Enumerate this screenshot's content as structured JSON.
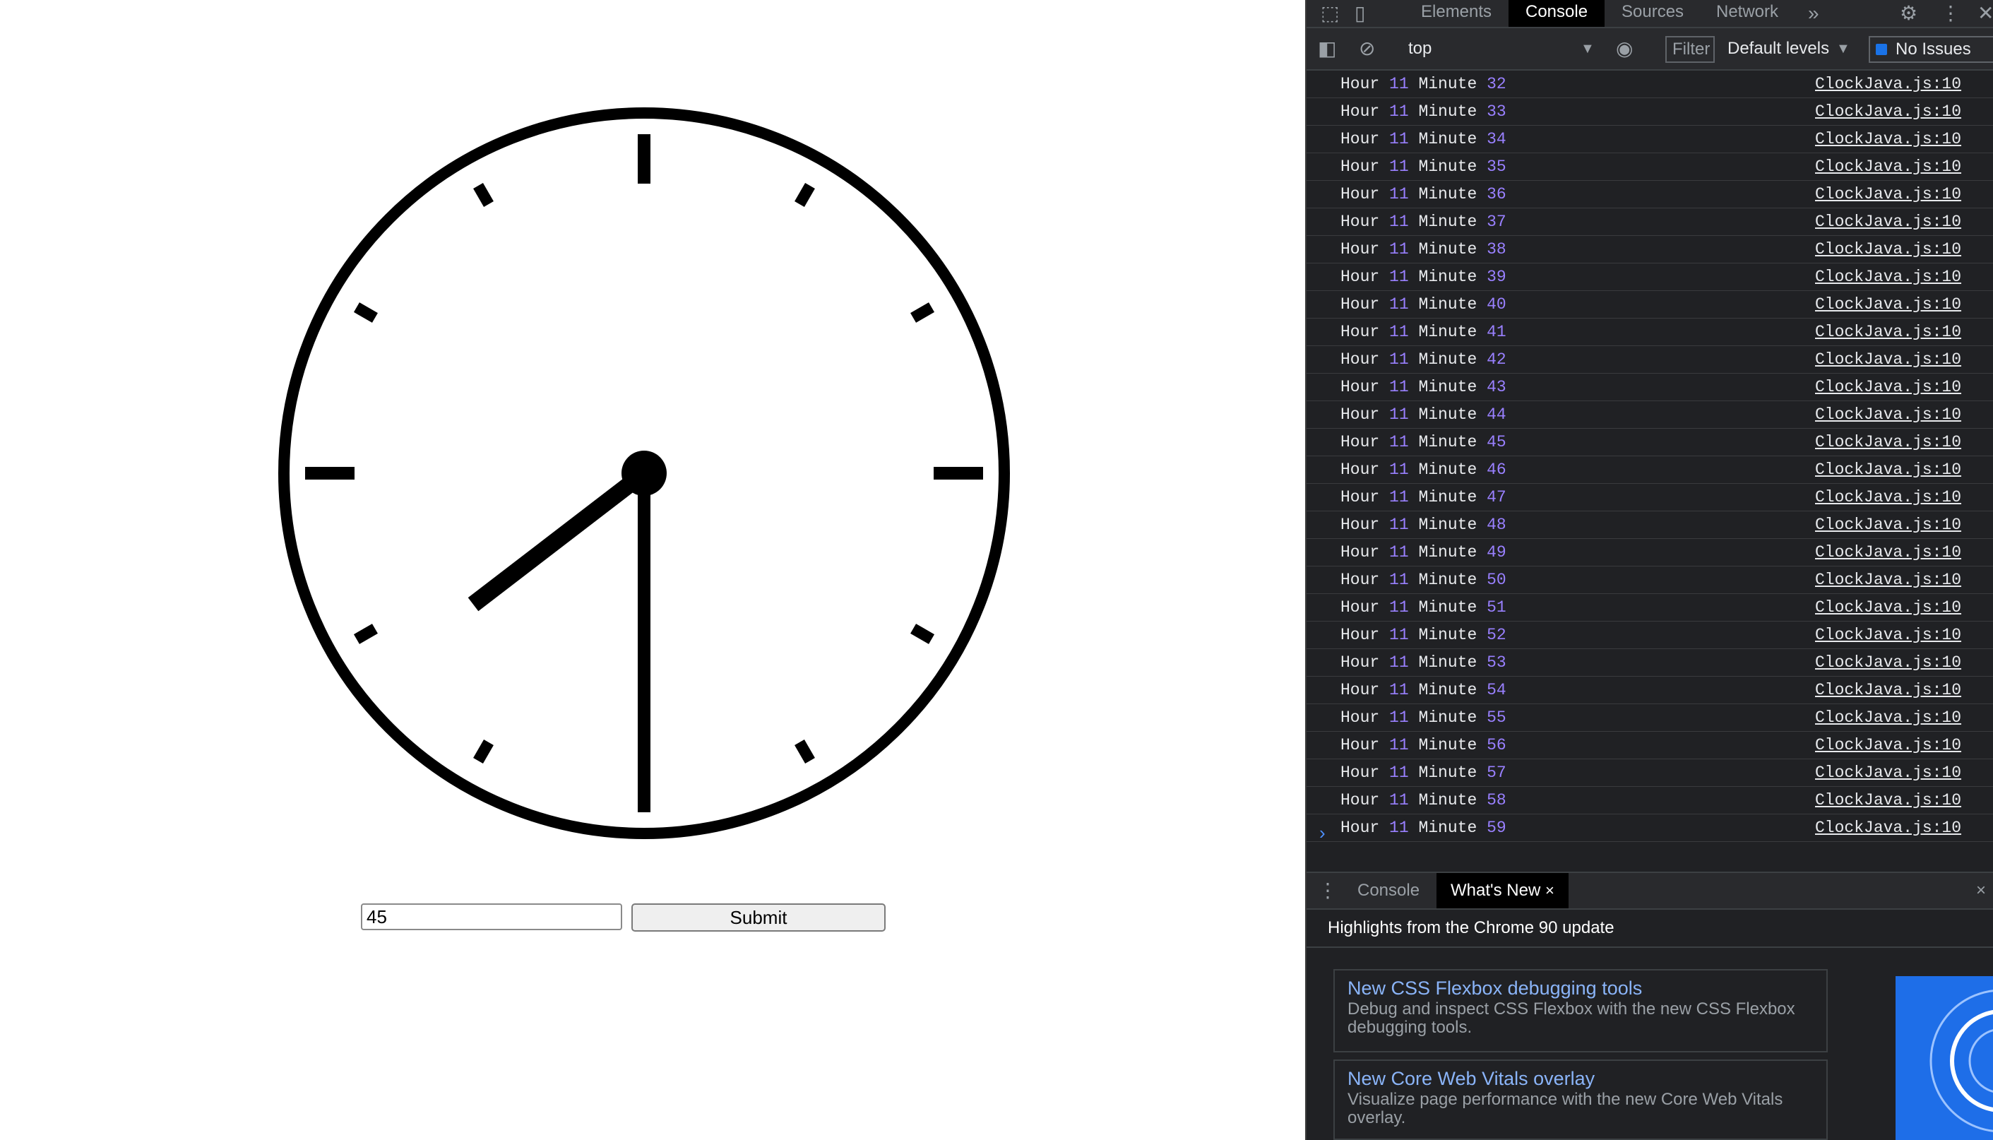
{
  "clock": {
    "hour_hand_value": 7.75,
    "minute_hand_value": 30,
    "colors": {
      "face": "#ffffff",
      "stroke": "#000000"
    }
  },
  "form": {
    "input_value": "45",
    "submit_label": "Submit"
  },
  "devtools": {
    "tabs": [
      "Elements",
      "Console",
      "Sources",
      "Network"
    ],
    "active_tab": "Console",
    "more_tabs_icon": "chevron-double-right-icon",
    "context": "top",
    "filter_placeholder": "Filter",
    "levels": "Default levels",
    "issues": "No Issues",
    "console": {
      "rows": [
        {
          "hour_word": "Hour",
          "hour": "11",
          "minute_word": "Minute",
          "minute": "32",
          "source": "ClockJava.js:10"
        },
        {
          "hour_word": "Hour",
          "hour": "11",
          "minute_word": "Minute",
          "minute": "33",
          "source": "ClockJava.js:10"
        },
        {
          "hour_word": "Hour",
          "hour": "11",
          "minute_word": "Minute",
          "minute": "34",
          "source": "ClockJava.js:10"
        },
        {
          "hour_word": "Hour",
          "hour": "11",
          "minute_word": "Minute",
          "minute": "35",
          "source": "ClockJava.js:10"
        },
        {
          "hour_word": "Hour",
          "hour": "11",
          "minute_word": "Minute",
          "minute": "36",
          "source": "ClockJava.js:10"
        },
        {
          "hour_word": "Hour",
          "hour": "11",
          "minute_word": "Minute",
          "minute": "37",
          "source": "ClockJava.js:10"
        },
        {
          "hour_word": "Hour",
          "hour": "11",
          "minute_word": "Minute",
          "minute": "38",
          "source": "ClockJava.js:10"
        },
        {
          "hour_word": "Hour",
          "hour": "11",
          "minute_word": "Minute",
          "minute": "39",
          "source": "ClockJava.js:10"
        },
        {
          "hour_word": "Hour",
          "hour": "11",
          "minute_word": "Minute",
          "minute": "40",
          "source": "ClockJava.js:10"
        },
        {
          "hour_word": "Hour",
          "hour": "11",
          "minute_word": "Minute",
          "minute": "41",
          "source": "ClockJava.js:10"
        },
        {
          "hour_word": "Hour",
          "hour": "11",
          "minute_word": "Minute",
          "minute": "42",
          "source": "ClockJava.js:10"
        },
        {
          "hour_word": "Hour",
          "hour": "11",
          "minute_word": "Minute",
          "minute": "43",
          "source": "ClockJava.js:10"
        },
        {
          "hour_word": "Hour",
          "hour": "11",
          "minute_word": "Minute",
          "minute": "44",
          "source": "ClockJava.js:10"
        },
        {
          "hour_word": "Hour",
          "hour": "11",
          "minute_word": "Minute",
          "minute": "45",
          "source": "ClockJava.js:10"
        },
        {
          "hour_word": "Hour",
          "hour": "11",
          "minute_word": "Minute",
          "minute": "46",
          "source": "ClockJava.js:10"
        },
        {
          "hour_word": "Hour",
          "hour": "11",
          "minute_word": "Minute",
          "minute": "47",
          "source": "ClockJava.js:10"
        },
        {
          "hour_word": "Hour",
          "hour": "11",
          "minute_word": "Minute",
          "minute": "48",
          "source": "ClockJava.js:10"
        },
        {
          "hour_word": "Hour",
          "hour": "11",
          "minute_word": "Minute",
          "minute": "49",
          "source": "ClockJava.js:10"
        },
        {
          "hour_word": "Hour",
          "hour": "11",
          "minute_word": "Minute",
          "minute": "50",
          "source": "ClockJava.js:10"
        },
        {
          "hour_word": "Hour",
          "hour": "11",
          "minute_word": "Minute",
          "minute": "51",
          "source": "ClockJava.js:10"
        },
        {
          "hour_word": "Hour",
          "hour": "11",
          "minute_word": "Minute",
          "minute": "52",
          "source": "ClockJava.js:10"
        },
        {
          "hour_word": "Hour",
          "hour": "11",
          "minute_word": "Minute",
          "minute": "53",
          "source": "ClockJava.js:10"
        },
        {
          "hour_word": "Hour",
          "hour": "11",
          "minute_word": "Minute",
          "minute": "54",
          "source": "ClockJava.js:10"
        },
        {
          "hour_word": "Hour",
          "hour": "11",
          "minute_word": "Minute",
          "minute": "55",
          "source": "ClockJava.js:10"
        },
        {
          "hour_word": "Hour",
          "hour": "11",
          "minute_word": "Minute",
          "minute": "56",
          "source": "ClockJava.js:10"
        },
        {
          "hour_word": "Hour",
          "hour": "11",
          "minute_word": "Minute",
          "minute": "57",
          "source": "ClockJava.js:10"
        },
        {
          "hour_word": "Hour",
          "hour": "11",
          "minute_word": "Minute",
          "minute": "58",
          "source": "ClockJava.js:10"
        },
        {
          "hour_word": "Hour",
          "hour": "11",
          "minute_word": "Minute",
          "minute": "59",
          "source": "ClockJava.js:10"
        }
      ],
      "prompt": "›"
    },
    "drawer": {
      "tabs": [
        "Console",
        "What's New"
      ],
      "active": "What's New",
      "close_tab": "×",
      "close_drawer": "×"
    },
    "whats_new": {
      "heading": "Highlights from the Chrome 90 update",
      "cards": [
        {
          "title": "New CSS Flexbox debugging tools",
          "desc": "Debug and inspect CSS Flexbox with the new CSS Flexbox debugging tools."
        },
        {
          "title": "New Core Web Vitals overlay",
          "desc": "Visualize page performance with the new Core Web Vitals overlay."
        }
      ]
    },
    "colors": {
      "bg": "#202124",
      "tab_active_bg": "#000000",
      "number": "#9980ff",
      "link": "#8ab4f8",
      "prompt": "#4d90fe"
    }
  }
}
